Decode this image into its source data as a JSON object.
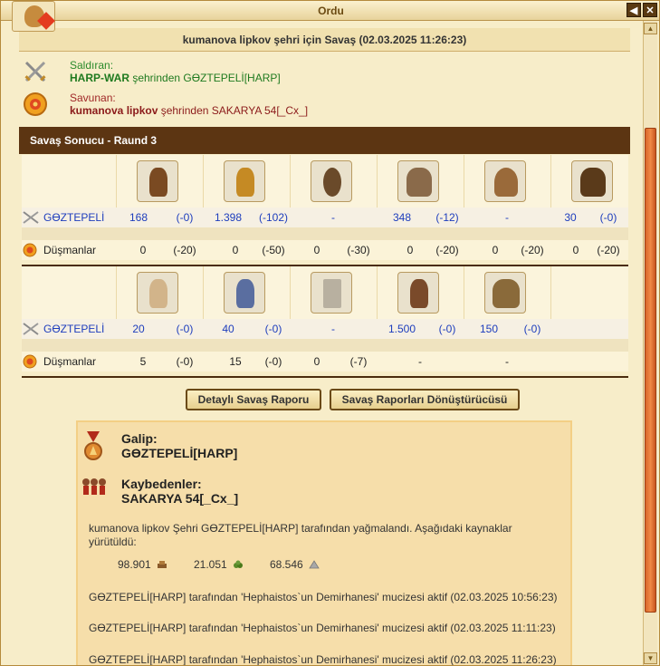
{
  "window": {
    "title": "Ordu"
  },
  "header": {
    "title": "kumanova lipkov şehri için Savaş (02.03.2025 11:26:23)"
  },
  "attacker": {
    "label": "Saldıran:",
    "city": "HARP-WAR",
    "text": " şehrinden GӨZTEPELİ[HARP]"
  },
  "defender": {
    "label": "Savunan:",
    "city": "kumanova lipkov",
    "text": " şehrinden SAKARYA 54[_Cx_]"
  },
  "round": {
    "title": "Savaş Sonucu - Raund 3"
  },
  "rows": {
    "ours_label": "GӨZTEPELİ",
    "enemy_label": "Düşmanlar"
  },
  "table1": {
    "units": [
      "hoplite-unit-icon",
      "spartan-unit-icon",
      "shield-warrior-unit-icon",
      "ballista-unit-icon",
      "balloon-unit-icon",
      "ram-unit-icon"
    ],
    "ours": [
      {
        "v": "168",
        "d": "(-0)"
      },
      {
        "v": "1.398",
        "d": "(-102)"
      },
      {
        "v": "-",
        "d": ""
      },
      {
        "v": "348",
        "d": "(-12)"
      },
      {
        "v": "-",
        "d": ""
      },
      {
        "v": "30",
        "d": "(-0)"
      }
    ],
    "enemy": [
      {
        "v": "0",
        "d": "(-20)"
      },
      {
        "v": "0",
        "d": "(-50)"
      },
      {
        "v": "0",
        "d": "(-30)"
      },
      {
        "v": "0",
        "d": "(-20)"
      },
      {
        "v": "0",
        "d": "(-20)"
      },
      {
        "v": "0",
        "d": "(-20)"
      }
    ]
  },
  "table2": {
    "units": [
      "cook-unit-icon",
      "doctor-unit-icon",
      "wall-unit-icon",
      "swordsman-unit-icon",
      "catapult-unit-icon"
    ],
    "ours": [
      {
        "v": "20",
        "d": "(-0)"
      },
      {
        "v": "40",
        "d": "(-0)"
      },
      {
        "v": "-",
        "d": ""
      },
      {
        "v": "1.500",
        "d": "(-0)"
      },
      {
        "v": "150",
        "d": "(-0)"
      }
    ],
    "enemy": [
      {
        "v": "5",
        "d": "(-0)"
      },
      {
        "v": "15",
        "d": "(-0)"
      },
      {
        "v": "0",
        "d": "(-7)"
      },
      {
        "v": "-",
        "d": ""
      },
      {
        "v": "-",
        "d": ""
      }
    ]
  },
  "buttons": {
    "detailed_report": "Detaylı Savaş Raporu",
    "report_converter": "Savaş Raporları Dönüştürücüsü"
  },
  "result": {
    "winner_label": "Galip:",
    "winner": "GӨZTEPELİ[HARP]",
    "losers_label": "Kaybedenler:",
    "losers": "SAKARYA 54[_Cx_]",
    "plunder_text": "kumanova lipkov Şehri GӨZTEPELİ[HARP] tarafından yağmalandı. Aşağıdaki kaynaklar yürütüldü:",
    "resources": [
      {
        "amount": "98.901",
        "icon": "wood-icon"
      },
      {
        "amount": "21.051",
        "icon": "wine-icon"
      },
      {
        "amount": "68.546",
        "icon": "marble-icon"
      }
    ],
    "wonders": [
      "GӨZTEPELİ[HARP] tarafından 'Hephaistos`un Demirhanesi' mucizesi aktif (02.03.2025 10:56:23)",
      "GӨZTEPELİ[HARP] tarafından 'Hephaistos`un Demirhanesi' mucizesi aktif (02.03.2025 11:11:23)",
      "GӨZTEPELİ[HARP] tarafından 'Hephaistos`un Demirhanesi' mucizesi aktif (02.03.2025 11:26:23)"
    ]
  },
  "colors": {
    "accent": "#5c3512",
    "ours": "#1d3dbd",
    "attacker": "#1f7a1f",
    "defender": "#8b1a1a"
  }
}
